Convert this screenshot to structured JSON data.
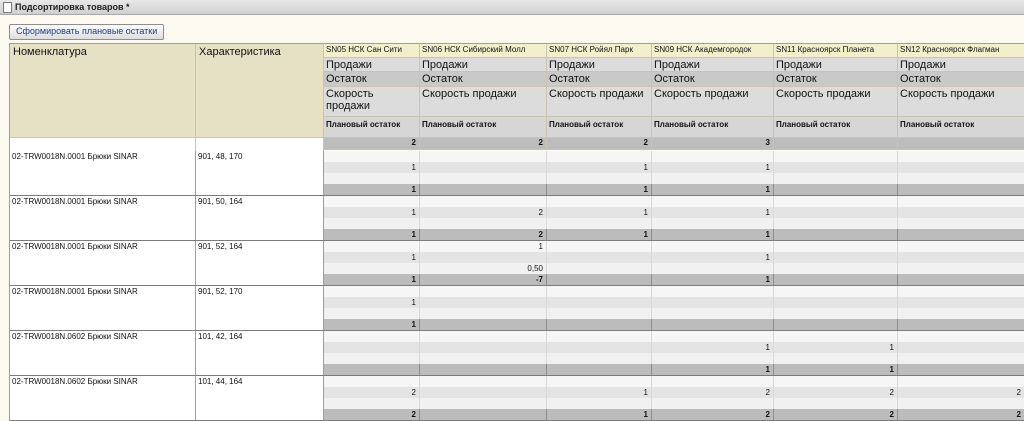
{
  "window": {
    "title": "Подсортировка товаров *"
  },
  "toolbar": {
    "generate_label": "Сформировать плановые остатки"
  },
  "grid": {
    "col_nomenclature": "Номенклатура",
    "col_characteristic": "Характеристика",
    "stores": [
      "SN05 НСК Сан Сити",
      "SN06 НСК Сибирский Молл",
      "SN07 НСК Ройял Парк",
      "SN09 НСК Академгородок",
      "SN11 Красноярск Планета",
      "SN12 Красноярск Флагман"
    ],
    "row_sales": "Продажи",
    "row_stock": "Остаток",
    "row_speed": "Скорость продажи",
    "row_plan": "Плановый остаток",
    "header_plan_values": [
      "2",
      "2",
      "2",
      "3",
      "",
      ""
    ],
    "rows": [
      {
        "nomenclature": "02-TRW0018N.0001 Брюки SINAR",
        "characteristic": "901, 48, 170",
        "sales": [
          "",
          "",
          "",
          "",
          "",
          ""
        ],
        "stock": [
          "1",
          "",
          "1",
          "1",
          "",
          ""
        ],
        "speed": [
          "",
          "",
          "",
          "",
          "",
          ""
        ],
        "plan": [
          "1",
          "",
          "1",
          "1",
          "",
          ""
        ]
      },
      {
        "nomenclature": "02-TRW0018N.0001 Брюки SINAR",
        "characteristic": "901, 50, 164",
        "sales": [
          "",
          "",
          "",
          "",
          "",
          ""
        ],
        "stock": [
          "1",
          "2",
          "1",
          "1",
          "",
          ""
        ],
        "speed": [
          "",
          "",
          "",
          "",
          "",
          ""
        ],
        "plan": [
          "1",
          "2",
          "1",
          "1",
          "",
          ""
        ]
      },
      {
        "nomenclature": "02-TRW0018N.0001 Брюки SINAR",
        "characteristic": "901, 52, 164",
        "sales": [
          "",
          "1",
          "",
          "",
          "",
          ""
        ],
        "stock": [
          "1",
          "",
          "",
          "1",
          "",
          ""
        ],
        "speed": [
          "",
          "0,50",
          "",
          "",
          "",
          ""
        ],
        "plan": [
          "1",
          "-7",
          "",
          "1",
          "",
          ""
        ]
      },
      {
        "nomenclature": "02-TRW0018N.0001 Брюки SINAR",
        "characteristic": "901, 52, 170",
        "sales": [
          "",
          "",
          "",
          "",
          "",
          ""
        ],
        "stock": [
          "1",
          "",
          "",
          "",
          "",
          ""
        ],
        "speed": [
          "",
          "",
          "",
          "",
          "",
          ""
        ],
        "plan": [
          "1",
          "",
          "",
          "",
          "",
          ""
        ]
      },
      {
        "nomenclature": "02-TRW0018N.0602 Брюки SINAR",
        "characteristic": "101, 42, 164",
        "sales": [
          "",
          "",
          "",
          "",
          "",
          ""
        ],
        "stock": [
          "",
          "",
          "",
          "1",
          "1",
          ""
        ],
        "speed": [
          "",
          "",
          "",
          "",
          "",
          ""
        ],
        "plan": [
          "",
          "",
          "",
          "1",
          "1",
          ""
        ]
      },
      {
        "nomenclature": "02-TRW0018N.0602 Брюки SINAR",
        "characteristic": "101, 44, 164",
        "sales": [
          "",
          "",
          "",
          "",
          "",
          ""
        ],
        "stock": [
          "2",
          "",
          "1",
          "2",
          "2",
          "2"
        ],
        "speed": [
          "",
          "",
          "",
          "",
          "",
          ""
        ],
        "plan": [
          "2",
          "",
          "1",
          "2",
          "2",
          "2"
        ]
      }
    ]
  }
}
